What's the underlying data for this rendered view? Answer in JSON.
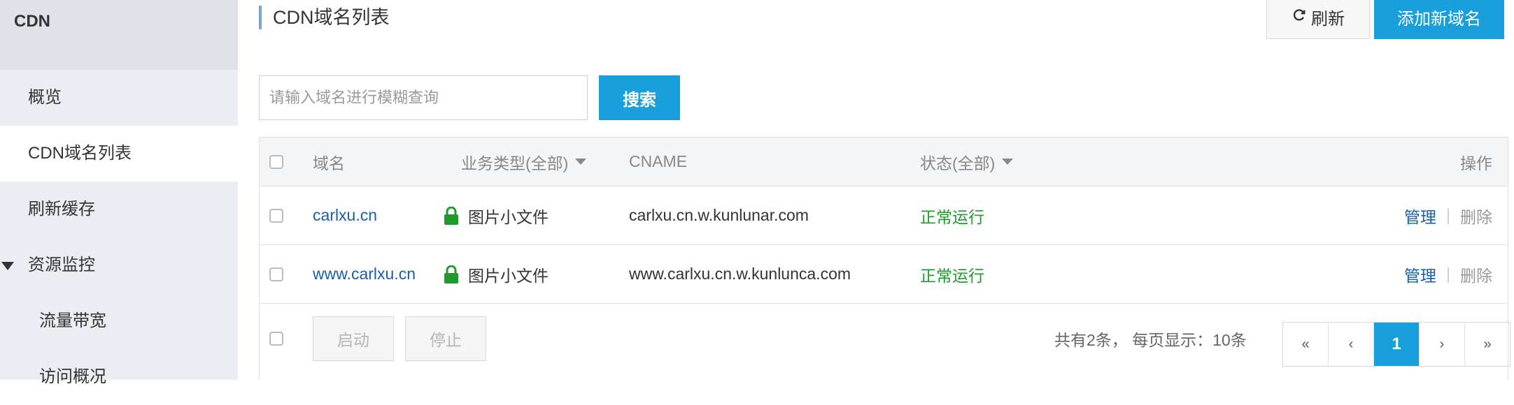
{
  "sidebar": {
    "brand": "CDN",
    "items": [
      {
        "label": "概览"
      },
      {
        "label": "CDN域名列表"
      },
      {
        "label": "刷新缓存"
      },
      {
        "label": "资源监控"
      },
      {
        "label": "流量带宽"
      },
      {
        "label": "访问概况"
      }
    ]
  },
  "header": {
    "title": "CDN域名列表",
    "refresh_label": "刷新",
    "add_label": "添加新域名"
  },
  "search": {
    "placeholder": "请输入域名进行模糊查询",
    "button_label": "搜索"
  },
  "table": {
    "columns": {
      "domain": "域名",
      "type": "业务类型(全部)",
      "cname": "CNAME",
      "status": "状态(全部)",
      "actions": "操作"
    },
    "rows": [
      {
        "domain": "carlxu.cn",
        "type": "图片小文件",
        "cname": "carlxu.cn.w.kunlunar.com",
        "status": "正常运行",
        "manage": "管理",
        "delete": "删除"
      },
      {
        "domain": "www.carlxu.cn",
        "type": "图片小文件",
        "cname": "www.carlxu.cn.w.kunlunca.com",
        "status": "正常运行",
        "manage": "管理",
        "delete": "删除"
      }
    ]
  },
  "footer": {
    "start_label": "启动",
    "stop_label": "停止",
    "pager_info": "共有2条， 每页显示：10条",
    "pager": {
      "first": "«",
      "prev": "‹",
      "current": "1",
      "next": "›",
      "last": "»"
    }
  },
  "colors": {
    "primary": "#1a9fdd",
    "link": "#1a5fa8",
    "ok": "#1f9b2b",
    "sidebar_bg": "#eaedf1"
  }
}
